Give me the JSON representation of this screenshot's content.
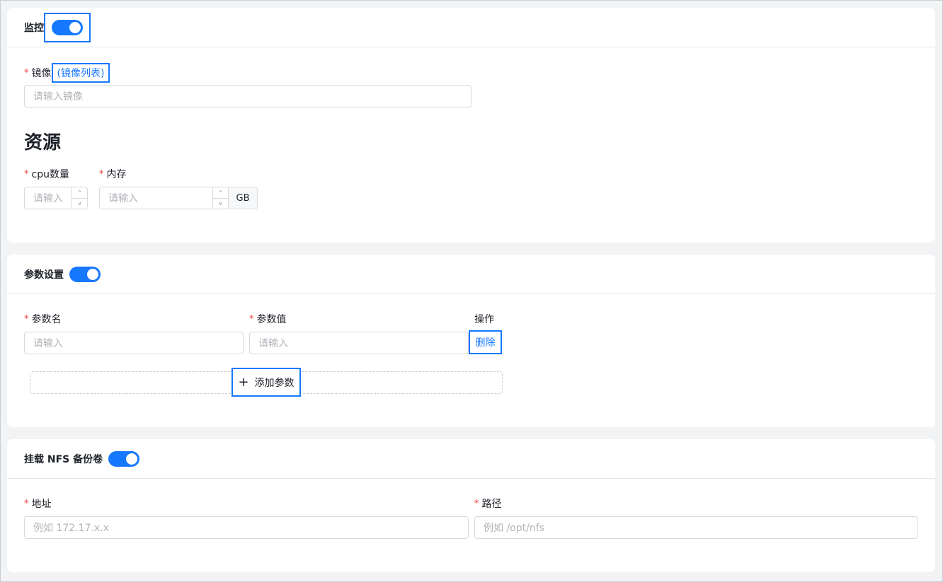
{
  "monitor": {
    "title": "监控",
    "image_label": "镜像",
    "image_list_link": "(镜像列表)",
    "image_placeholder": "请输入镜像",
    "resource_title": "资源",
    "cpu_label": "cpu数量",
    "cpu_placeholder": "请输入",
    "memory_label": "内存",
    "memory_placeholder": "请输入",
    "memory_unit": "GB",
    "step_up": "^",
    "step_down": "v"
  },
  "params": {
    "title": "参数设置",
    "name_col": "参数名",
    "value_col": "参数值",
    "action_col": "操作",
    "name_placeholder": "请输入",
    "value_placeholder": "请输入",
    "delete_label": "删除",
    "add_label": "添加参数",
    "plus_glyph": "+"
  },
  "nfs": {
    "title": "挂载 NFS 备份卷",
    "address_label": "地址",
    "address_placeholder": "例如 172.17.x.x",
    "path_label": "路径",
    "path_placeholder": "例如 /opt/nfs"
  },
  "required_mark": "*",
  "colors": {
    "accent": "#1677ff",
    "required": "#f53f3f"
  }
}
